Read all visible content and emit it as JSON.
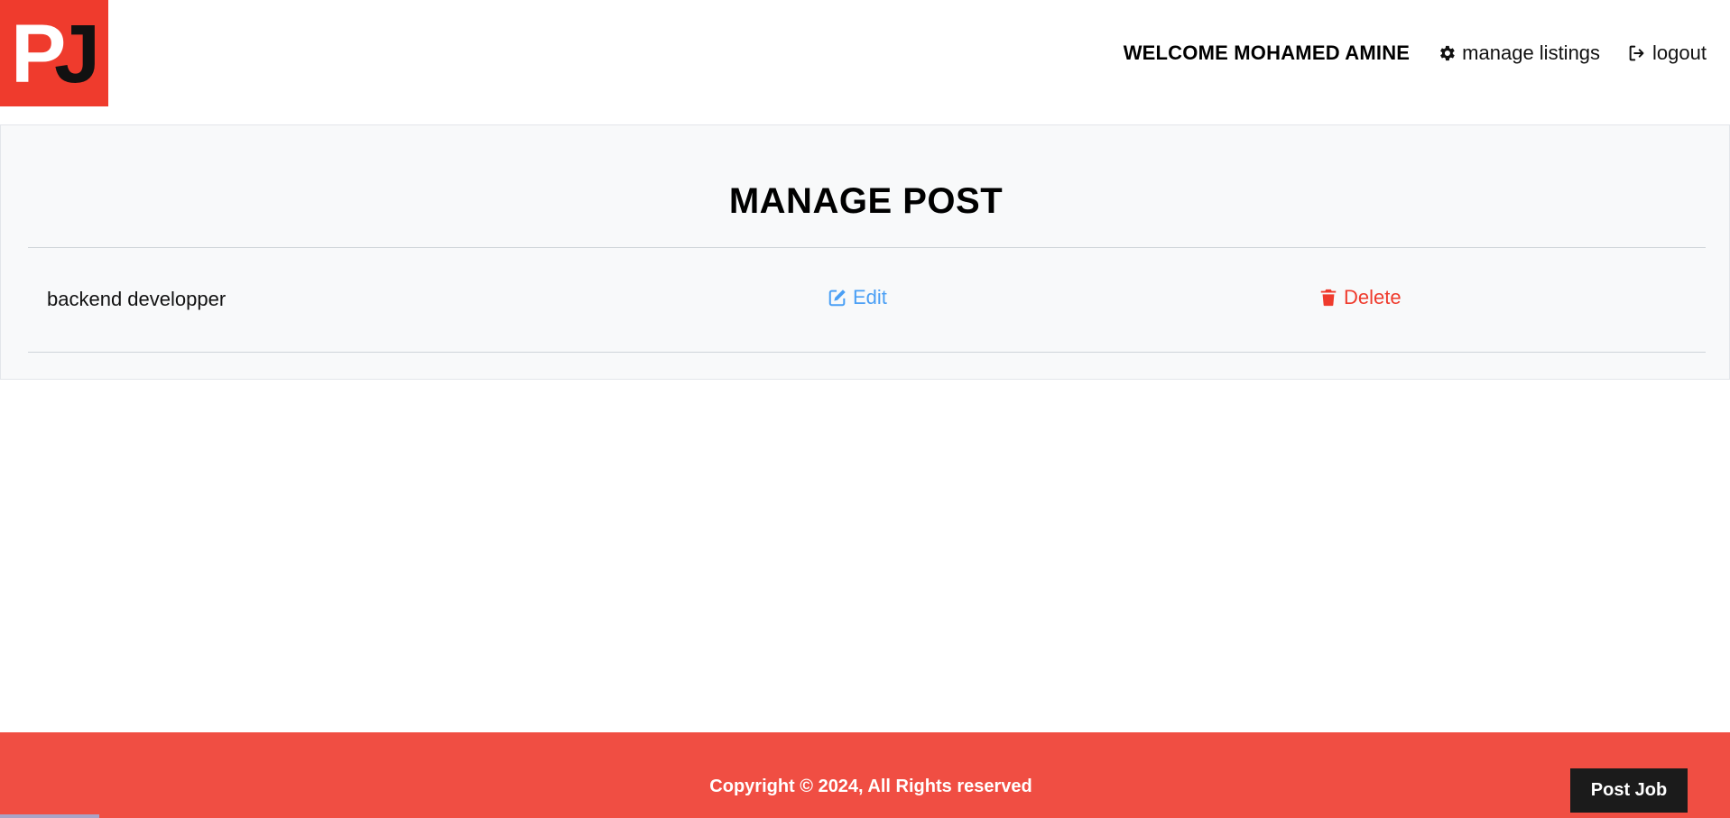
{
  "brand": {
    "logo_p": "P",
    "logo_j": "J",
    "color": "#ef3b2d"
  },
  "nav": {
    "welcome": "WELCOME MOHAMED AMINE",
    "manage_listings": "manage listings",
    "logout": "logout",
    "icons": {
      "manage": "gear-icon",
      "logout": "logout-icon"
    }
  },
  "panel": {
    "title": "MANAGE POST",
    "posts": [
      {
        "title": "backend developper",
        "edit_label": "Edit",
        "delete_label": "Delete"
      }
    ],
    "colors": {
      "edit": "#4a9ff5",
      "delete": "#ef3b2d"
    }
  },
  "footer": {
    "copyright": "Copyright © 2024, All Rights reserved",
    "post_job": "Post Job",
    "color": "#f04e43"
  }
}
